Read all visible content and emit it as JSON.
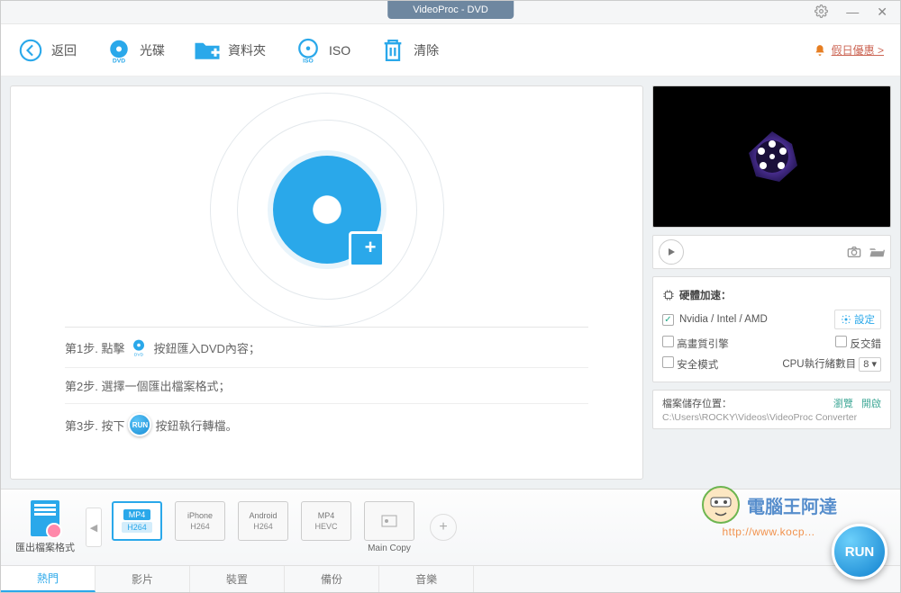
{
  "titlebar": {
    "title": "VideoProc - DVD"
  },
  "toolbar": {
    "back": "返回",
    "disc": "光碟",
    "folder": "資料夾",
    "iso": "ISO",
    "clear": "清除",
    "promo": "假日優惠 >"
  },
  "steps": {
    "s1a": "第1步. 點擊",
    "s1b": "按鈕匯入DVD內容；",
    "s2": "第2步. 選擇一個匯出檔案格式；",
    "s3a": "第3步. 按下",
    "s3b": "按鈕執行轉檔。",
    "runBadge": "RUN"
  },
  "side": {
    "hwaccel": "硬體加速：",
    "gpu": "Nvidia / Intel / AMD",
    "settings": "設定",
    "hq": "高畫質引擎",
    "deint": "反交錯",
    "safe": "安全模式",
    "threads": "CPU執行緒數目",
    "threadsVal": "8",
    "saveLoc": "檔案儲存位置：",
    "browse": "瀏覽",
    "open": "開啟",
    "path": "C:\\Users\\ROCKY\\Videos\\VideoProc Converter"
  },
  "formats": {
    "label": "匯出檔案格式",
    "presets": [
      {
        "top": "MP4",
        "sub": "H264",
        "active": true
      },
      {
        "top": "iPhone",
        "sub": "H264",
        "active": false
      },
      {
        "top": "Android",
        "sub": "H264",
        "active": false
      },
      {
        "top": "MP4",
        "sub": "HEVC",
        "active": false
      },
      {
        "top": "",
        "sub": "",
        "name": "Main Copy",
        "active": false
      }
    ]
  },
  "tabs": [
    "熱門",
    "影片",
    "裝置",
    "備份",
    "音樂"
  ],
  "run": "RUN",
  "watermark": {
    "name": "電腦王阿達",
    "url": "http://www.kocp..."
  }
}
